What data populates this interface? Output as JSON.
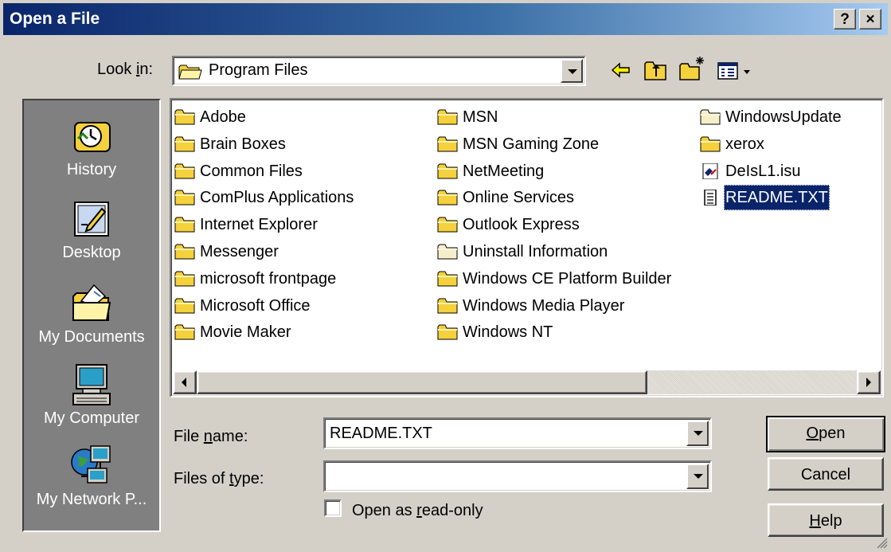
{
  "window": {
    "title": "Open a File",
    "help_label": "?",
    "close_label": "×"
  },
  "lookin": {
    "label_pre": "Look ",
    "label_u": "i",
    "label_post": "n:",
    "value": "Program Files"
  },
  "places": [
    {
      "label": "History",
      "icon": "history-icon"
    },
    {
      "label": "Desktop",
      "icon": "desktop-icon"
    },
    {
      "label": "My Documents",
      "icon": "my-documents-icon"
    },
    {
      "label": "My Computer",
      "icon": "my-computer-icon"
    },
    {
      "label": "My Network P...",
      "icon": "my-network-places-icon"
    }
  ],
  "files": {
    "col1": [
      "Adobe",
      "Brain Boxes",
      "Common Files",
      "ComPlus Applications",
      "Internet Explorer",
      "Messenger",
      "microsoft frontpage",
      "Microsoft Office",
      "Movie Maker"
    ],
    "col2": [
      "MSN",
      "MSN Gaming Zone",
      "NetMeeting",
      "Online Services",
      "Outlook Express",
      "Uninstall Information",
      "Windows CE Platform Builder",
      "Windows Media Player",
      "Windows NT"
    ],
    "col3": [
      "WindowsUpdate",
      "xerox",
      "DeIsL1.isu",
      "README.TXT"
    ]
  },
  "filename": {
    "label_pre": "File ",
    "label_u": "n",
    "label_post": "ame:",
    "value": "README.TXT"
  },
  "filetype": {
    "label_pre": "Files of ",
    "label_u": "t",
    "label_post": "ype:",
    "value": ""
  },
  "readonly": {
    "label_pre": "Open as ",
    "label_u": "r",
    "label_post": "ead-only",
    "checked": false
  },
  "buttons": {
    "open_u": "O",
    "open_rest": "pen",
    "cancel": "Cancel",
    "help_u": "H",
    "help_rest": "elp"
  },
  "colors": {
    "title_start": "#0a246a",
    "title_end": "#a6caf0",
    "face": "#d4d0c8",
    "selection": "#0a246a",
    "folder": "#f4d13d"
  }
}
